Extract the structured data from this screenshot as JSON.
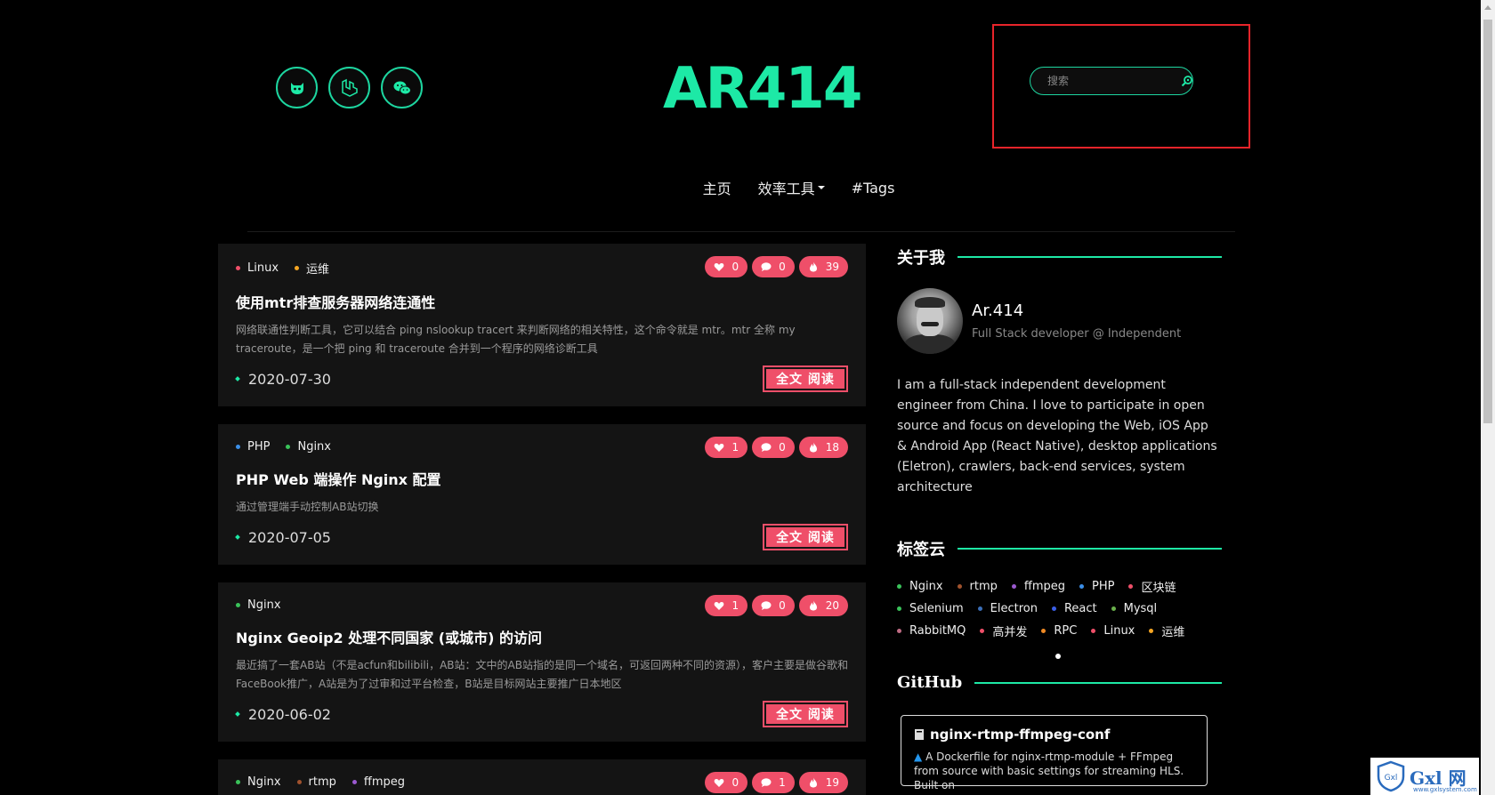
{
  "header": {
    "logo": "AR414",
    "social": [
      {
        "name": "github-icon"
      },
      {
        "name": "laravel-icon"
      },
      {
        "name": "wechat-icon"
      }
    ],
    "search": {
      "placeholder": "搜索"
    }
  },
  "nav": {
    "home": "主页",
    "tools": "效率工具",
    "tags": "#Tags"
  },
  "colors": {
    "accent": "#1de9a6",
    "pink": "#ef4f69",
    "highlight": "#e8242a"
  },
  "posts": [
    {
      "tags": [
        {
          "label": "Linux",
          "color": "#ef4f69"
        },
        {
          "label": "运维",
          "color": "#f5a623"
        }
      ],
      "likes": "0",
      "comments": "0",
      "views": "39",
      "title": "使用mtr排查服务器网络连通性",
      "desc": "网络联通性判断工具，它可以结合 ping nslookup tracert 来判断网络的相关特性，这个命令就是 mtr。mtr 全称 my traceroute，是一个把 ping 和 traceroute 合并到一个程序的网络诊断工具",
      "date": "2020-07-30",
      "read": "全文 阅读"
    },
    {
      "tags": [
        {
          "label": "PHP",
          "color": "#3b8fe8"
        },
        {
          "label": "Nginx",
          "color": "#3ac35a"
        }
      ],
      "likes": "1",
      "comments": "0",
      "views": "18",
      "title": "PHP Web 端操作 Nginx 配置",
      "desc": "通过管理端手动控制AB站切换",
      "date": "2020-07-05",
      "read": "全文 阅读"
    },
    {
      "tags": [
        {
          "label": "Nginx",
          "color": "#3ac35a"
        }
      ],
      "likes": "1",
      "comments": "0",
      "views": "20",
      "title": "Nginx Geoip2 处理不同国家 (或城市) 的访问",
      "desc": "最近搞了一套AB站（不是acfun和bilibili，AB站：文中的AB站指的是同一个域名，可返回两种不同的资源），客户主要是做谷歌和FaceBook推广，A站是为了过审和过平台检查，B站是目标网站主要推广日本地区",
      "date": "2020-06-02",
      "read": "全文 阅读"
    },
    {
      "tags": [
        {
          "label": "Nginx",
          "color": "#3ac35a"
        },
        {
          "label": "rtmp",
          "color": "#a0522d"
        },
        {
          "label": "ffmpeg",
          "color": "#9b59d0"
        }
      ],
      "likes": "0",
      "comments": "1",
      "views": "19",
      "title": "",
      "desc": "",
      "date": "",
      "read": ""
    }
  ],
  "sidebar": {
    "about_title": "关于我",
    "name": "Ar.414",
    "role": "Full Stack developer @ Independent",
    "bio": "I am a full-stack independent development engineer from China. I love to participate in open source and focus on developing the Web, iOS App & Android App (React Native), desktop applications (Eletron), crawlers, back-end services, system architecture",
    "tagcloud_title": "标签云",
    "tagcloud": [
      {
        "label": "Nginx",
        "color": "#3ac35a"
      },
      {
        "label": "rtmp",
        "color": "#a0522d"
      },
      {
        "label": "ffmpeg",
        "color": "#9b59d0"
      },
      {
        "label": "PHP",
        "color": "#3b8fe8"
      },
      {
        "label": "区块链",
        "color": "#ef4f69"
      },
      {
        "label": "Selenium",
        "color": "#3ac35a"
      },
      {
        "label": "Electron",
        "color": "#3b6fb8"
      },
      {
        "label": "React",
        "color": "#3b5fe8"
      },
      {
        "label": "Mysql",
        "color": "#6ab04c"
      },
      {
        "label": "RabbitMQ",
        "color": "#c06c84"
      },
      {
        "label": "高并发",
        "color": "#ef4f69"
      },
      {
        "label": "RPC",
        "color": "#f08a24"
      },
      {
        "label": "Linux",
        "color": "#ef4f69"
      },
      {
        "label": "运维",
        "color": "#f5a623"
      }
    ],
    "github_title": "GitHub",
    "repo": {
      "title": "nginx-rtmp-ffmpeg-conf",
      "desc": "A Dockerfile for nginx-rtmp-module + FFmpeg from source with basic settings for streaming HLS. Built on"
    }
  },
  "watermark": {
    "text": "Gxl 网",
    "sub": "www.gxlsystem.com"
  }
}
